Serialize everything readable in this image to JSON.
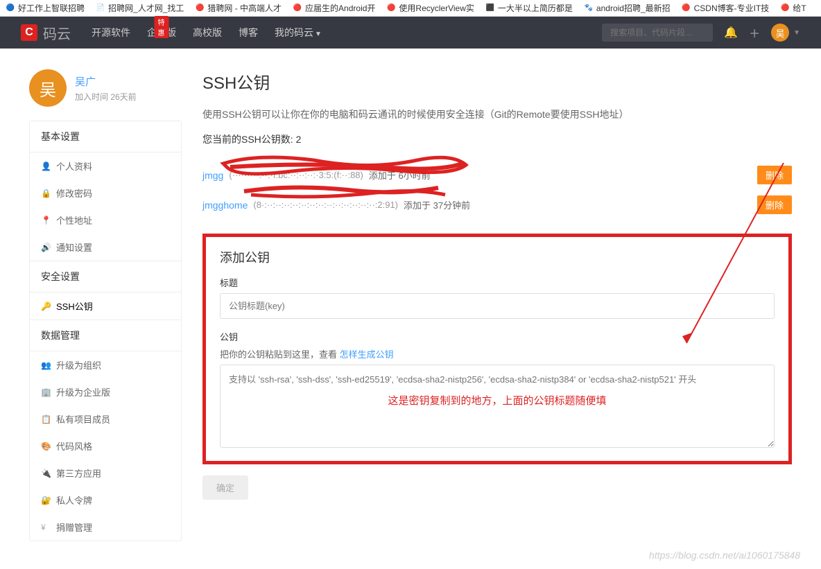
{
  "browser_tabs": [
    {
      "favicon": "🔵",
      "title": "好工作上智联招聘"
    },
    {
      "favicon": "📄",
      "title": "招聘网_人才网_找工"
    },
    {
      "favicon": "🔴",
      "title": "猎聘网 - 中高端人才"
    },
    {
      "favicon": "🔴",
      "title": "应届生的Android开"
    },
    {
      "favicon": "🔴",
      "title": "使用RecyclerView实"
    },
    {
      "favicon": "⬛",
      "title": "一大半以上简历都是"
    },
    {
      "favicon": "🐾",
      "title": "android招聘_最新招"
    },
    {
      "favicon": "🔴",
      "title": "CSDN博客-专业IT技"
    },
    {
      "favicon": "🔴",
      "title": "给T"
    }
  ],
  "logo": {
    "badge": "C",
    "text": "码云"
  },
  "nav": {
    "items": [
      "开源软件",
      "企业版",
      "高校版",
      "博客",
      "我的码云"
    ],
    "special_badge": "特惠",
    "search_placeholder": "搜索项目、代码片段..."
  },
  "profile": {
    "avatar_char": "吴",
    "name": "吴广",
    "joined": "加入时间 26天前"
  },
  "sidebar": {
    "section1_title": "基本设置",
    "section1_items": [
      {
        "icon": "👤",
        "label": "个人资料"
      },
      {
        "icon": "🔒",
        "label": "修改密码"
      },
      {
        "icon": "📍",
        "label": "个性地址"
      },
      {
        "icon": "🔊",
        "label": "通知设置"
      }
    ],
    "section2_title": "安全设置",
    "section2_items": [
      {
        "icon": "🔑",
        "label": "SSH公钥"
      }
    ],
    "section3_title": "数据管理",
    "section3_items": [
      {
        "icon": "👥",
        "label": "升级为组织"
      },
      {
        "icon": "🏢",
        "label": "升级为企业版"
      },
      {
        "icon": "📋",
        "label": "私有项目成员"
      },
      {
        "icon": "🎨",
        "label": "代码风格"
      },
      {
        "icon": "🔌",
        "label": "第三方应用"
      },
      {
        "icon": "🔐",
        "label": "私人令牌"
      },
      {
        "icon": "¥",
        "label": "捐赠管理"
      }
    ]
  },
  "main": {
    "title": "SSH公钥",
    "description": "使用SSH公钥可以让你在你的电脑和码云通讯的时候使用安全连接（Git的Remote要使用SSH地址）",
    "count_prefix": "您当前的SSH公钥数: ",
    "count": "2",
    "keys": [
      {
        "name": "jmgg",
        "fingerprint": "(·········:··:·f:bc:··:··:··:·3:5:(f:··:88)",
        "added_prefix": "添加于 ",
        "added": "6小时前",
        "delete": "删除"
      },
      {
        "name": "jmgghome",
        "fingerprint": "(8·:··:··:··:··:··:··:··:··:··:··:··:··:··:2:91)",
        "added_prefix": "添加于 ",
        "added": "37分钟前",
        "delete": "删除"
      }
    ],
    "add_section": {
      "title": "添加公钥",
      "title_label": "标题",
      "title_placeholder": "公钥标题(key)",
      "key_label": "公钥",
      "key_help_prefix": "把你的公钥粘贴到这里，查看 ",
      "key_help_link": "怎样生成公钥",
      "key_placeholder": "支持以 'ssh-rsa', 'ssh-dss', 'ssh-ed25519', 'ecdsa-sha2-nistp256', 'ecdsa-sha2-nistp384' or 'ecdsa-sha2-nistp521' 开头",
      "submit": "确定"
    }
  },
  "annotation": "这是密钥复制到的地方，上面的公钥标题随便填",
  "watermark": "https://blog.csdn.net/ai1060175848"
}
